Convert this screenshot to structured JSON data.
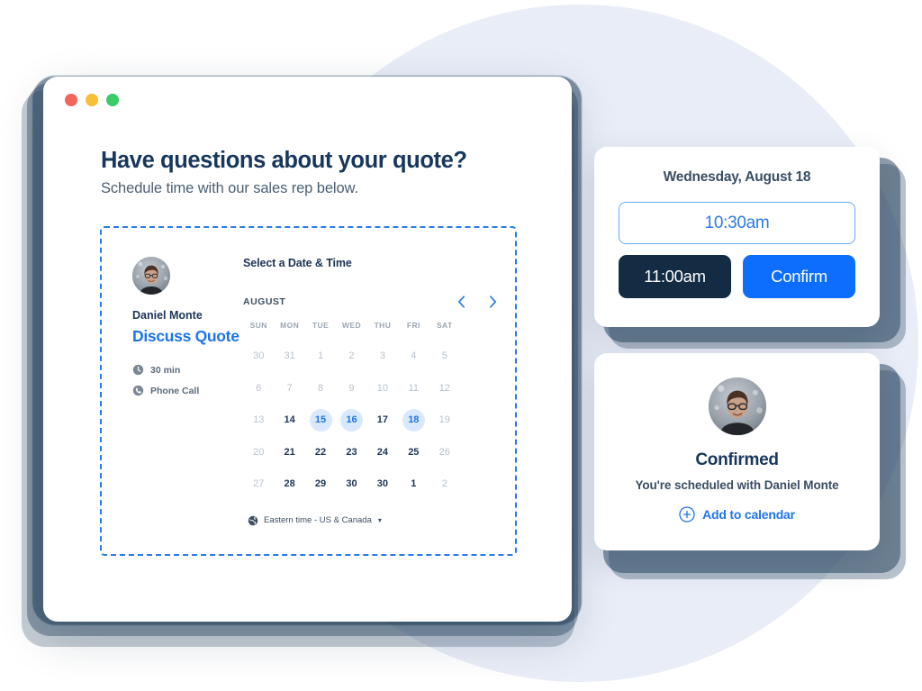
{
  "window": {
    "traffic_lights": [
      "close",
      "minimize",
      "maximize"
    ],
    "title": "Have questions about your quote?",
    "subtitle": "Schedule time with our sales rep below."
  },
  "scheduler": {
    "host": {
      "avatar_icon": "avatar-photo",
      "name": "Daniel Monte",
      "event_name": "Discuss Quote",
      "meta": [
        {
          "icon": "clock-icon",
          "label": "30 min"
        },
        {
          "icon": "phone-icon",
          "label": "Phone Call"
        }
      ]
    },
    "calendar": {
      "heading": "Select a Date & Time",
      "month_label": "AUGUST",
      "prev_icon": "chevron-left-icon",
      "next_icon": "chevron-right-icon",
      "weekdays": [
        "SUN",
        "MON",
        "TUE",
        "WED",
        "THU",
        "FRI",
        "SAT"
      ],
      "weeks": [
        [
          {
            "d": "30",
            "state": "muted"
          },
          {
            "d": "31",
            "state": "muted"
          },
          {
            "d": "1",
            "state": "muted"
          },
          {
            "d": "2",
            "state": "muted"
          },
          {
            "d": "3",
            "state": "muted"
          },
          {
            "d": "4",
            "state": "muted"
          },
          {
            "d": "5",
            "state": "muted"
          }
        ],
        [
          {
            "d": "6",
            "state": "muted"
          },
          {
            "d": "7",
            "state": "muted"
          },
          {
            "d": "8",
            "state": "muted"
          },
          {
            "d": "9",
            "state": "muted"
          },
          {
            "d": "10",
            "state": "muted"
          },
          {
            "d": "11",
            "state": "muted"
          },
          {
            "d": "12",
            "state": "muted"
          }
        ],
        [
          {
            "d": "13",
            "state": "muted"
          },
          {
            "d": "14",
            "state": "normal"
          },
          {
            "d": "15",
            "state": "available"
          },
          {
            "d": "16",
            "state": "available"
          },
          {
            "d": "17",
            "state": "normal"
          },
          {
            "d": "18",
            "state": "available"
          },
          {
            "d": "19",
            "state": "muted"
          }
        ],
        [
          {
            "d": "20",
            "state": "muted"
          },
          {
            "d": "21",
            "state": "normal"
          },
          {
            "d": "22",
            "state": "normal"
          },
          {
            "d": "23",
            "state": "normal"
          },
          {
            "d": "24",
            "state": "normal"
          },
          {
            "d": "25",
            "state": "normal"
          },
          {
            "d": "26",
            "state": "muted"
          }
        ],
        [
          {
            "d": "27",
            "state": "muted"
          },
          {
            "d": "28",
            "state": "normal"
          },
          {
            "d": "29",
            "state": "normal"
          },
          {
            "d": "30",
            "state": "normal"
          },
          {
            "d": "30",
            "state": "normal"
          },
          {
            "d": "1",
            "state": "normal"
          },
          {
            "d": "2",
            "state": "muted"
          }
        ]
      ],
      "timezone": {
        "icon": "globe-icon",
        "label": "Eastern time - US & Canada",
        "caret": "▾"
      }
    }
  },
  "time_card": {
    "date_label": "Wednesday, August 18",
    "selected_slot": "10:30am",
    "next_slot": "11:00am",
    "confirm_label": "Confirm"
  },
  "confirmation_card": {
    "avatar_icon": "avatar-photo",
    "title": "Confirmed",
    "subtitle": "You're scheduled with Daniel Monte",
    "add_to_calendar": {
      "icon": "plus-circle-icon",
      "label": "Add to calendar"
    }
  },
  "colors": {
    "accent_blue": "#1f74e8",
    "primary_blue": "#0d6efd",
    "dark_navy": "#132c44",
    "heading_navy": "#17375c",
    "available_bg": "#d9e9fd",
    "dashed_border": "#2c7be5",
    "bg_circle": "#e9edf7",
    "dot_red": "#f4645b",
    "dot_yellow": "#f8bf39",
    "dot_green": "#3acc68"
  }
}
